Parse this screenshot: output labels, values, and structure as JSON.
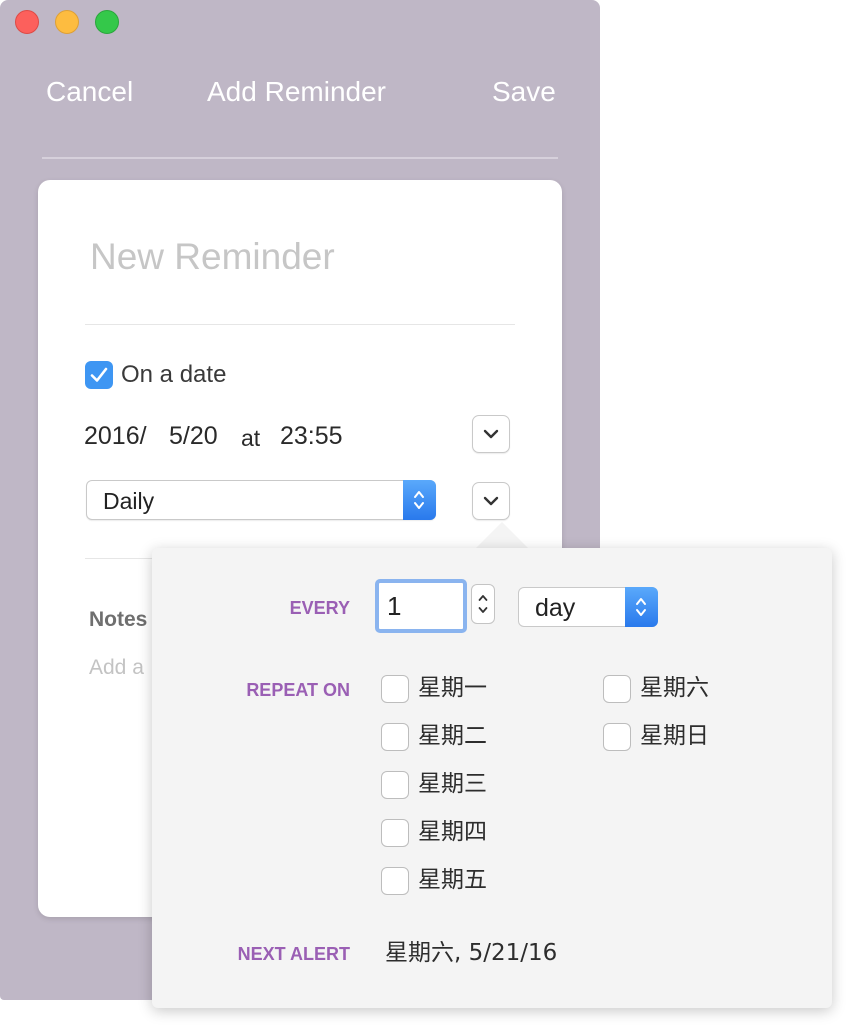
{
  "window": {
    "title": "Add Reminder"
  },
  "header": {
    "cancel_label": "Cancel",
    "title": "Add Reminder",
    "save_label": "Save"
  },
  "form": {
    "title_placeholder": "New Reminder",
    "on_date_label": "On a date",
    "on_date_checked": true,
    "date": {
      "year": "2016/",
      "month_day": "5/20",
      "at": "at",
      "time": "23:55"
    },
    "repeat_value": "Daily",
    "notes_label": "Notes",
    "notes_placeholder": "Add a"
  },
  "popover": {
    "every_label": "EVERY",
    "every_value": "1",
    "unit_value": "day",
    "repeat_on_label": "REPEAT ON",
    "days": [
      {
        "label": "星期一",
        "checked": false
      },
      {
        "label": "星期二",
        "checked": false
      },
      {
        "label": "星期三",
        "checked": false
      },
      {
        "label": "星期四",
        "checked": false
      },
      {
        "label": "星期五",
        "checked": false
      },
      {
        "label": "星期六",
        "checked": false
      },
      {
        "label": "星期日",
        "checked": false
      }
    ],
    "next_alert_label": "NEXT ALERT",
    "next_alert_value": "星期六, 5/21/16"
  },
  "colors": {
    "window_bg": "#bfb7c6",
    "accent_blue": "#3e96f3",
    "label_purple": "#9a5fb4",
    "traffic_red": "#fc605c",
    "traffic_yellow": "#fdbc40",
    "traffic_green": "#34c84a"
  },
  "icons": [
    "close-icon",
    "minimize-icon",
    "zoom-icon",
    "checkmark-icon",
    "chevron-down-icon",
    "stepper-arrows-icon"
  ]
}
